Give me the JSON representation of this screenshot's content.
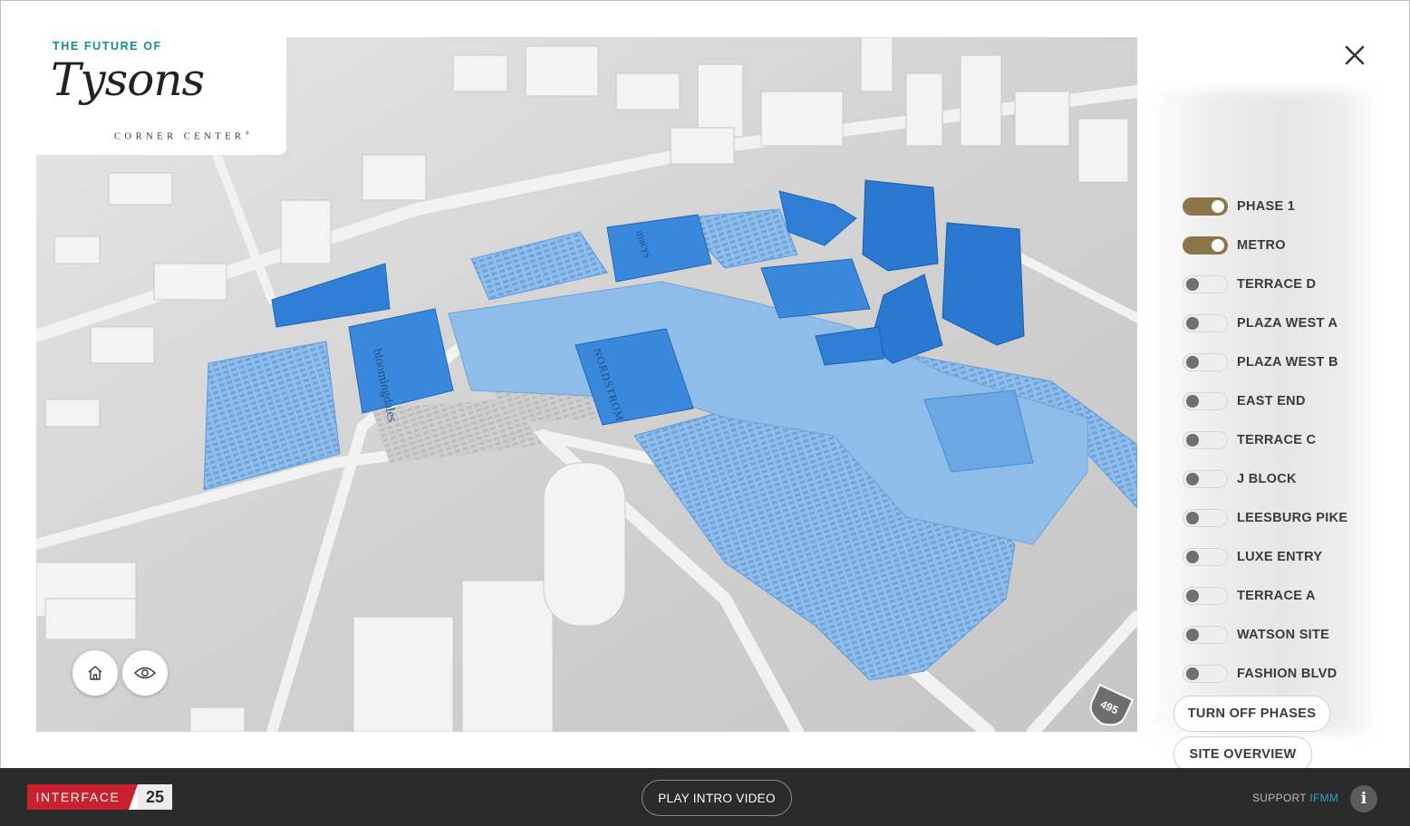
{
  "branding": {
    "kicker": "THE FUTURE OF",
    "logo_script": "Tysons",
    "logo_sub": "CORNER CENTER",
    "logo_sup": "®"
  },
  "map": {
    "store_labels": [
      "bloomingdales",
      "NORDSTROM",
      "macys"
    ],
    "highway_shield": "495",
    "highlight_color": "#3f8ede"
  },
  "layers": [
    {
      "label": "PHASE 1",
      "on": true
    },
    {
      "label": "METRO",
      "on": true
    },
    {
      "label": "TERRACE D",
      "on": false
    },
    {
      "label": "PLAZA WEST A",
      "on": false
    },
    {
      "label": "PLAZA WEST B",
      "on": false
    },
    {
      "label": "EAST END",
      "on": false
    },
    {
      "label": "TERRACE C",
      "on": false
    },
    {
      "label": "J BLOCK",
      "on": false
    },
    {
      "label": "LEESBURG PIKE",
      "on": false
    },
    {
      "label": "LUXE ENTRY",
      "on": false
    },
    {
      "label": "TERRACE A",
      "on": false
    },
    {
      "label": "WATSON SITE",
      "on": false
    },
    {
      "label": "FASHION BLVD",
      "on": false
    }
  ],
  "actions": {
    "turn_off": "TURN OFF PHASES",
    "site_overview": "SITE OVERVIEW"
  },
  "footer": {
    "brand_left": "INTERFACE",
    "brand_right": "25",
    "play_video": "PLAY INTRO VIDEO",
    "support_prefix": "SUPPORT",
    "support_accent": "IFMM",
    "info_glyph": "i"
  },
  "icons": {
    "close": "close-icon",
    "home": "home-icon",
    "eye": "eye-icon",
    "info": "info-icon"
  },
  "colors": {
    "toggle_on": "#8c7549",
    "brand_red": "#c8202f",
    "accent_teal": "#0f8d9a",
    "footer_bg": "#2b2b2b"
  }
}
